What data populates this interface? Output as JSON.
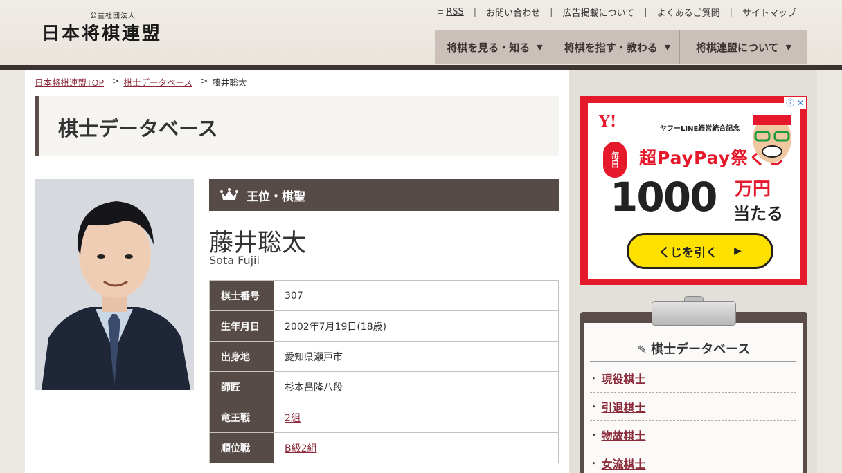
{
  "header": {
    "logo_sub": "公益社団法人",
    "logo_main": "日本将棋連盟",
    "util_links": [
      "RSS",
      "お問い合わせ",
      "広告掲載について",
      "よくあるご質問",
      "サイトマップ"
    ],
    "main_nav": [
      "将棋を見る・知る",
      "将棋を指す・教わる",
      "将棋連盟について"
    ]
  },
  "breadcrumb": {
    "home": "日本将棋連盟TOP",
    "section": "棋士データベース",
    "current": "藤井聡太"
  },
  "page_title": "棋士データベース",
  "player": {
    "titles": "王位・棋聖",
    "name_jp": "藤井聡太",
    "name_en": "Sota Fujii",
    "rows": [
      {
        "label": "棋士番号",
        "value": "307",
        "link": false
      },
      {
        "label": "生年月日",
        "value": "2002年7月19日(18歳)",
        "link": false
      },
      {
        "label": "出身地",
        "value": "愛知県瀬戸市",
        "link": false
      },
      {
        "label": "師匠",
        "value": "杉本昌隆八段",
        "link": false
      },
      {
        "label": "竜王戦",
        "value": "2組",
        "link": true
      },
      {
        "label": "順位戦",
        "value": "B級2組",
        "link": true
      }
    ]
  },
  "ad": {
    "logo": "Y!",
    "headline": "ヤフーLINE経営統合記念",
    "daily": "毎日",
    "title": "超PayPay祭くじ",
    "amount": "1000",
    "amount_unit": "万円",
    "amount_sub": "当たる",
    "cta": "くじを引く"
  },
  "sidebar": {
    "db_heading": "棋士データベース",
    "db_links": [
      "現役棋士",
      "引退棋士",
      "物故棋士",
      "女流棋士"
    ]
  }
}
